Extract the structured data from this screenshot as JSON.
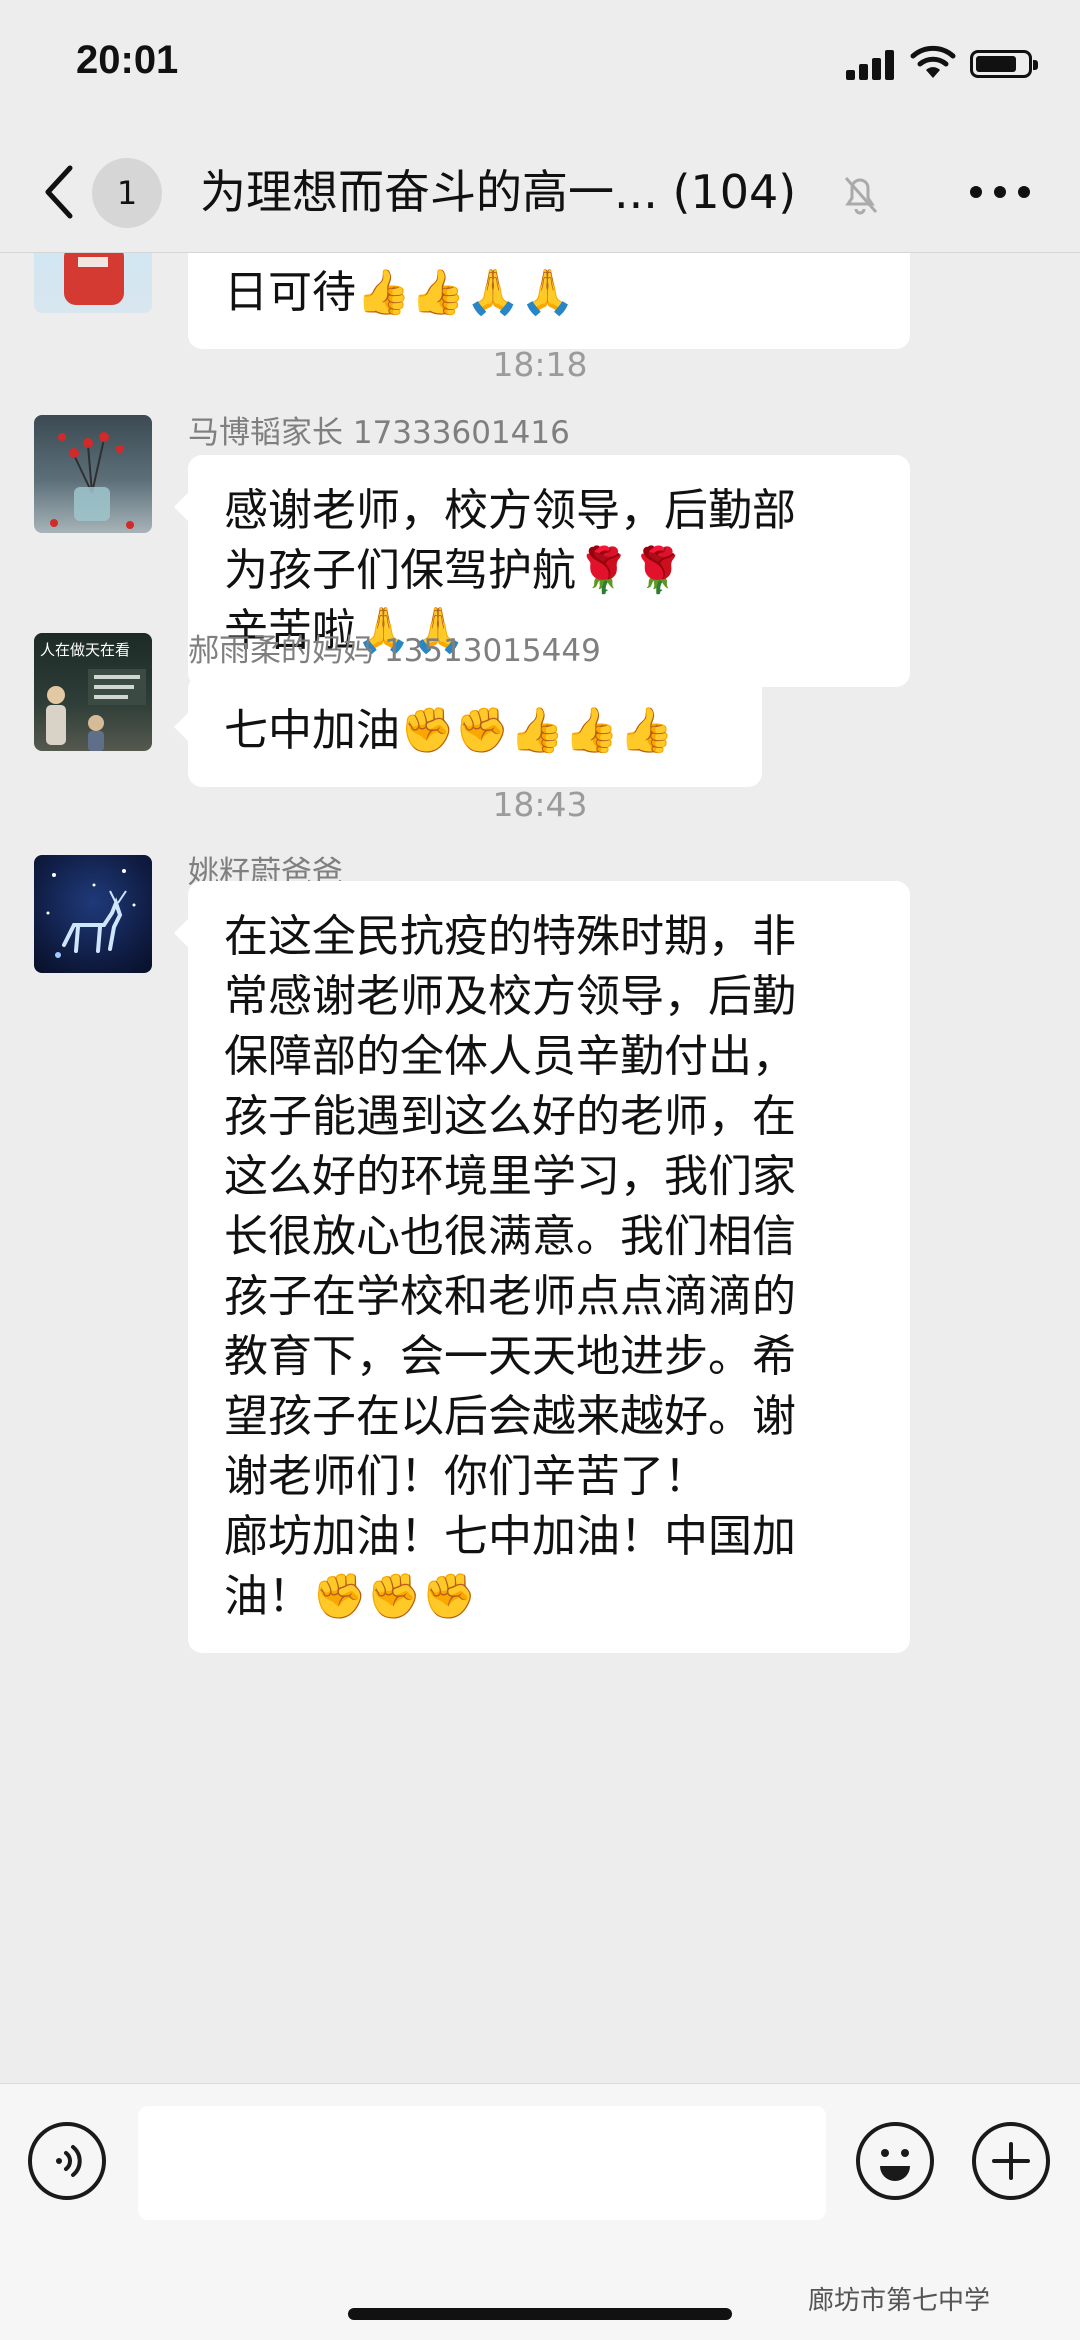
{
  "status_bar": {
    "time": "20:01",
    "battery_level": 0.8
  },
  "header": {
    "back_icon": "chevron-left-icon",
    "unread_count": "1",
    "title": "为理想而奋斗的高一... (104)",
    "muted_icon": "bell-off-icon",
    "more_icon": "more-dots-icon"
  },
  "messages": [
    {
      "sender": "",
      "avatar": "child-red-shirt-avatar",
      "text": "七中加油廊坊加油战胜疫情指\n日可待👍👍🙏🙏"
    },
    {
      "timestamp": "18:18"
    },
    {
      "sender": "马博韬家长 17333601416",
      "avatar": "red-berries-vase-avatar",
      "text": "感谢老师，校方领导，后勤部\n为孩子们保驾护航🌹🌹\n辛苦啦🙏🙏"
    },
    {
      "sender": "郝雨柔的妈妈 13513015449",
      "avatar": "rainy-night-avatar",
      "avatar_caption": "人在做天在看",
      "text": "七中加油✊✊👍👍👍"
    },
    {
      "timestamp": "18:43"
    },
    {
      "sender": "姚籽蔚爸爸",
      "avatar": "deer-starry-night-avatar",
      "text": "在这全民抗疫的特殊时期，非\n常感谢老师及校方领导，后勤\n保障部的全体人员辛勤付出，\n孩子能遇到这么好的老师，在\n这么好的环境里学习，我们家\n长很放心也很满意。我们相信\n孩子在学校和老师点点滴滴的\n教育下，会一天天地进步。希\n望孩子在以后会越来越好。谢\n谢老师们！你们辛苦了！\n廊坊加油！七中加油！中国加\n油！✊✊✊"
    }
  ],
  "input_bar": {
    "voice_icon": "voice-wave-icon",
    "emoji_icon": "smiley-icon",
    "plus_icon": "plus-icon"
  },
  "watermark": "廊坊市第七中学",
  "colors": {
    "background": "#ededed",
    "bubble": "#ffffff",
    "meta_text": "#7f7f7f"
  }
}
